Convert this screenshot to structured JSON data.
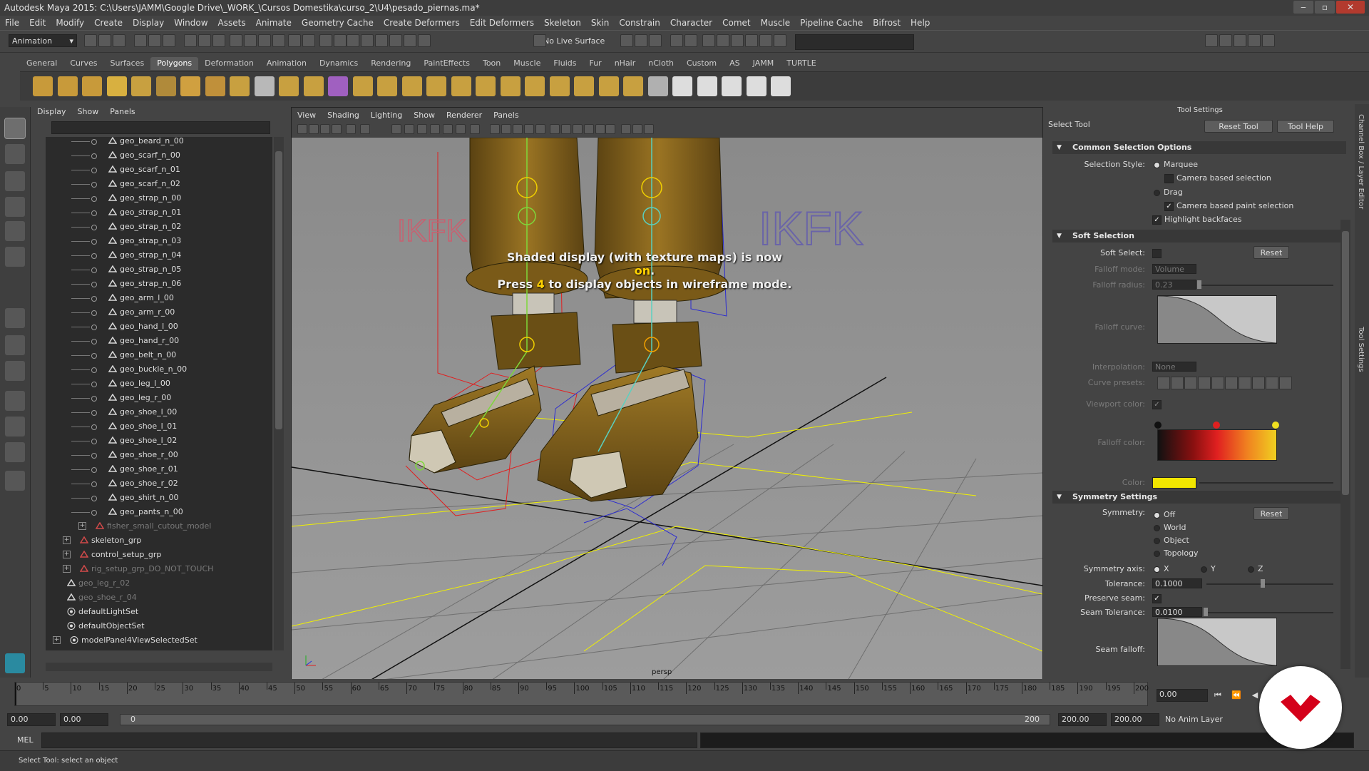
{
  "window": {
    "title": "Autodesk Maya 2015: C:\\Users\\JAMM\\Google Drive\\_WORK_\\Cursos Domestika\\curso_2\\U4\\pesado_piernas.ma*",
    "minimize": "‒",
    "maximize": "▫",
    "close": "✕"
  },
  "menu": [
    "File",
    "Edit",
    "Modify",
    "Create",
    "Display",
    "Window",
    "Assets",
    "Animate",
    "Geometry Cache",
    "Create Deformers",
    "Edit Deformers",
    "Skeleton",
    "Skin",
    "Constrain",
    "Character",
    "Comet",
    "Muscle",
    "Pipeline Cache",
    "Bifrost",
    "Help"
  ],
  "status": {
    "mode": "Animation",
    "mode_arrow": "▾",
    "live_surface": "No Live Surface"
  },
  "shelf_tabs": [
    "General",
    "Curves",
    "Surfaces",
    "Polygons",
    "Deformation",
    "Animation",
    "Dynamics",
    "Rendering",
    "PaintEffects",
    "Toon",
    "Muscle",
    "Fluids",
    "Fur",
    "nHair",
    "nCloth",
    "Custom",
    "AS",
    "JAMM",
    "TURTLE"
  ],
  "shelf_active": "Polygons",
  "outliner": {
    "menu": [
      "Display",
      "Show",
      "Panels"
    ],
    "items": [
      {
        "label": "geo_beard_n_00",
        "indent": 2,
        "type": "mesh"
      },
      {
        "label": "geo_scarf_n_00",
        "indent": 2,
        "type": "mesh"
      },
      {
        "label": "geo_scarf_n_01",
        "indent": 2,
        "type": "mesh"
      },
      {
        "label": "geo_scarf_n_02",
        "indent": 2,
        "type": "mesh"
      },
      {
        "label": "geo_strap_n_00",
        "indent": 2,
        "type": "mesh"
      },
      {
        "label": "geo_strap_n_01",
        "indent": 2,
        "type": "mesh"
      },
      {
        "label": "geo_strap_n_02",
        "indent": 2,
        "type": "mesh"
      },
      {
        "label": "geo_strap_n_03",
        "indent": 2,
        "type": "mesh"
      },
      {
        "label": "geo_strap_n_04",
        "indent": 2,
        "type": "mesh"
      },
      {
        "label": "geo_strap_n_05",
        "indent": 2,
        "type": "mesh"
      },
      {
        "label": "geo_strap_n_06",
        "indent": 2,
        "type": "mesh"
      },
      {
        "label": "geo_arm_l_00",
        "indent": 2,
        "type": "mesh"
      },
      {
        "label": "geo_arm_r_00",
        "indent": 2,
        "type": "mesh"
      },
      {
        "label": "geo_hand_l_00",
        "indent": 2,
        "type": "mesh"
      },
      {
        "label": "geo_hand_r_00",
        "indent": 2,
        "type": "mesh"
      },
      {
        "label": "geo_belt_n_00",
        "indent": 2,
        "type": "mesh"
      },
      {
        "label": "geo_buckle_n_00",
        "indent": 2,
        "type": "mesh"
      },
      {
        "label": "geo_leg_l_00",
        "indent": 2,
        "type": "mesh"
      },
      {
        "label": "geo_leg_r_00",
        "indent": 2,
        "type": "mesh"
      },
      {
        "label": "geo_shoe_l_00",
        "indent": 2,
        "type": "mesh"
      },
      {
        "label": "geo_shoe_l_01",
        "indent": 2,
        "type": "mesh"
      },
      {
        "label": "geo_shoe_l_02",
        "indent": 2,
        "type": "mesh"
      },
      {
        "label": "geo_shoe_r_00",
        "indent": 2,
        "type": "mesh"
      },
      {
        "label": "geo_shoe_r_01",
        "indent": 2,
        "type": "mesh"
      },
      {
        "label": "geo_shoe_r_02",
        "indent": 2,
        "type": "mesh"
      },
      {
        "label": "geo_shirt_n_00",
        "indent": 2,
        "type": "mesh"
      },
      {
        "label": "geo_pants_n_00",
        "indent": 2,
        "type": "mesh"
      },
      {
        "label": "fisher_small_cutout_model",
        "indent": 1,
        "type": "group",
        "dim": true
      },
      {
        "label": "skeleton_grp",
        "indent": 0,
        "type": "group"
      },
      {
        "label": "control_setup_grp",
        "indent": 0,
        "type": "group"
      },
      {
        "label": "rig_setup_grp_DO_NOT_TOUCH",
        "indent": 0,
        "type": "group",
        "dim": true
      },
      {
        "label": "geo_leg_r_02",
        "indent": -1,
        "type": "mesh",
        "dim": true
      },
      {
        "label": "geo_shoe_r_04",
        "indent": -1,
        "type": "mesh",
        "dim": true
      },
      {
        "label": "defaultLightSet",
        "indent": -1,
        "type": "set"
      },
      {
        "label": "defaultObjectSet",
        "indent": -1,
        "type": "set"
      },
      {
        "label": "modelPanel4ViewSelectedSet",
        "indent": -2,
        "type": "set"
      }
    ]
  },
  "viewport": {
    "menu": [
      "View",
      "Shading",
      "Lighting",
      "Show",
      "Renderer",
      "Panels"
    ],
    "hud_line1_a": "Shaded display (with texture maps) is now ",
    "hud_line1_b": "on",
    "hud_line1_c": ".",
    "hud_line2_a": "Press ",
    "hud_line2_b": "4",
    "hud_line2_c": " to display objects in wireframe mode.",
    "label_left": "IKFK",
    "label_right": "IKFK",
    "camera": "persp"
  },
  "tool_settings": {
    "header": "Tool Settings",
    "tool_name": "Select Tool",
    "reset_tool": "Reset Tool",
    "tool_help": "Tool Help",
    "common": {
      "title": "Common Selection Options",
      "selection_style": "Selection Style:",
      "marquee": "Marquee",
      "camera_based_selection": "Camera based selection",
      "drag": "Drag",
      "camera_based_paint": "Camera based paint selection",
      "highlight_backfaces": "Highlight backfaces"
    },
    "soft": {
      "title": "Soft Selection",
      "soft_select": "Soft Select:",
      "reset": "Reset",
      "falloff_mode": "Falloff mode:",
      "falloff_mode_value": "Volume",
      "falloff_radius": "Falloff radius:",
      "falloff_radius_value": "0.23",
      "falloff_curve": "Falloff curve:",
      "interpolation": "Interpolation:",
      "interpolation_value": "None",
      "curve_presets": "Curve presets:",
      "viewport_color": "Viewport color:",
      "falloff_color": "Falloff color:",
      "color": "Color:",
      "color_swatch": "#f2e600"
    },
    "symmetry": {
      "title": "Symmetry Settings",
      "symmetry": "Symmetry:",
      "reset": "Reset",
      "options": [
        "Off",
        "World",
        "Object",
        "Topology"
      ],
      "axis_label": "Symmetry axis:",
      "axes": [
        "X",
        "Y",
        "Z"
      ],
      "tolerance": "Tolerance:",
      "tolerance_value": "0.1000",
      "preserve_seam": "Preserve seam:",
      "seam_tolerance": "Seam Tolerance:",
      "seam_tolerance_value": "0.0100",
      "seam_falloff": "Seam falloff:"
    },
    "check": "✓",
    "collapse": "▼"
  },
  "side_tabs": [
    "Channel Box / Layer Editor",
    "Tool Settings"
  ],
  "timeline": {
    "ticks": [
      "0",
      "5",
      "10",
      "15",
      "20",
      "25",
      "30",
      "35",
      "40",
      "45",
      "50",
      "55",
      "60",
      "65",
      "70",
      "75",
      "80",
      "85",
      "90",
      "95",
      "100",
      "105",
      "110",
      "115",
      "120",
      "125",
      "130",
      "135",
      "140",
      "145",
      "150",
      "155",
      "160",
      "165",
      "170",
      "175",
      "180",
      "185",
      "190",
      "195",
      "200"
    ],
    "current_frame": "0.00",
    "buttons": [
      "⏮",
      "⏪",
      "◀",
      "▶",
      "⏩",
      "⏭"
    ]
  },
  "range": {
    "start": "0.00",
    "playback_start": "0.00",
    "slider_start": "0",
    "slider_end": "200",
    "playback_end": "200.00",
    "end": "200.00",
    "anim_layer": "No Anim Layer"
  },
  "mel": {
    "label": "MEL"
  },
  "help_line": "Select Tool: select an object",
  "colors": {
    "accent_yellow": "#ffd200",
    "ikfk_left": "#c86070",
    "ikfk_right": "#6a64a8",
    "wire_blue": "#2c2cd0",
    "wire_red": "#e02020",
    "wire_yellow": "#f0f000",
    "logo_red": "#d4001a"
  }
}
